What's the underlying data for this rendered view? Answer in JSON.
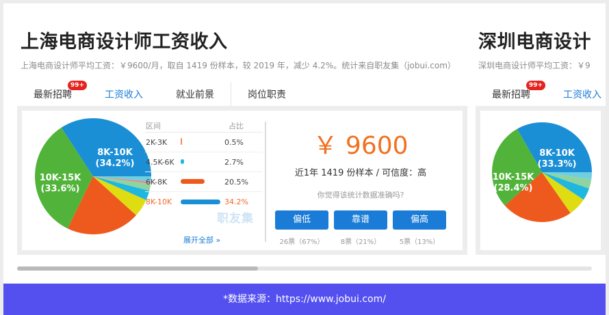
{
  "cards": [
    {
      "title": "上海电商设计师工资收入",
      "subtitle": "上海电商设计师平均工资：￥9600/月，取自 1419 份样本，较 2019 年，减少 4.2%。统计来自职友集（jobui.com）",
      "tabs": [
        {
          "label": "最新招聘",
          "badge": "99+"
        },
        {
          "label": "工资收入"
        },
        {
          "label": "就业前景"
        },
        {
          "label": "岗位职责"
        }
      ],
      "pie": {
        "slices": [
          {
            "label": "8K-10K",
            "pct_text": "(34.2%)",
            "value": 34.2,
            "color": "#1b8fd6"
          },
          {
            "label": "10K-15K",
            "pct_text": "(33.6%)",
            "value": 33.6,
            "color": "#52b33a"
          },
          {
            "label": "",
            "pct_text": "",
            "value": 20.5,
            "color": "#ee5a1e"
          },
          {
            "label": "",
            "pct_text": "",
            "value": 5.0,
            "color": "#dfdc12"
          },
          {
            "label": "",
            "pct_text": "",
            "value": 2.7,
            "color": "#1fb7df"
          },
          {
            "label": "",
            "pct_text": "",
            "value": 2.0,
            "color": "#8fd3a0"
          },
          {
            "label": "",
            "pct_text": "",
            "value": 0.5,
            "color": "#f08080"
          },
          {
            "label": "",
            "pct_text": "",
            "value": 1.5,
            "color": "#6fcfe0"
          }
        ]
      },
      "distribution": {
        "col_range": "区间",
        "col_pct": "占比",
        "rows": [
          {
            "range": "2K-3K",
            "pct": "0.5%",
            "value": 0.5,
            "color": "#f08a6a",
            "highlight": false
          },
          {
            "range": "4.5K-6K",
            "pct": "2.7%",
            "value": 2.7,
            "color": "#1fb7df",
            "highlight": false
          },
          {
            "range": "6K-8K",
            "pct": "20.5%",
            "value": 20.5,
            "color": "#ee5a1e",
            "highlight": false
          },
          {
            "range": "8K-10K",
            "pct": "34.2%",
            "value": 34.2,
            "color": "#1b8fd6",
            "highlight": true
          }
        ],
        "expand_label": "展开全部 »",
        "watermark": "职友集"
      },
      "salary": {
        "value": "￥ 9600",
        "samples": "近1年 1419 份样本 / 可信度：高",
        "question": "你觉得该统计数据准确吗?",
        "votes": [
          {
            "label": "偏低",
            "count": "26票（67%）"
          },
          {
            "label": "靠谱",
            "count": "8票（21%）"
          },
          {
            "label": "偏高",
            "count": "5票（13%）"
          }
        ]
      }
    },
    {
      "title": "深圳电商设计",
      "subtitle": "深圳电商设计师平均工资：￥9",
      "tabs": [
        {
          "label": "最新招聘",
          "badge": "99+"
        },
        {
          "label": "工资收入"
        }
      ],
      "pie": {
        "slices": [
          {
            "label": "8K-10K",
            "pct_text": "(33.3%)",
            "value": 33.3,
            "color": "#1b8fd6"
          },
          {
            "label": "10K-15K",
            "pct_text": "(28.4%)",
            "value": 28.4,
            "color": "#52b33a"
          },
          {
            "label": "",
            "pct_text": "",
            "value": 23.0,
            "color": "#ee5a1e"
          },
          {
            "label": "",
            "pct_text": "",
            "value": 6.0,
            "color": "#dfdc12"
          },
          {
            "label": "",
            "pct_text": "",
            "value": 4.0,
            "color": "#1fb7df"
          },
          {
            "label": "",
            "pct_text": "",
            "value": 3.0,
            "color": "#8fd3a0"
          },
          {
            "label": "",
            "pct_text": "",
            "value": 2.3,
            "color": "#6fcfe0"
          }
        ]
      }
    }
  ],
  "scrollbar": {
    "position": 0.42
  },
  "footer": {
    "text": "*数据来源：https://www.jobui.com/"
  }
}
